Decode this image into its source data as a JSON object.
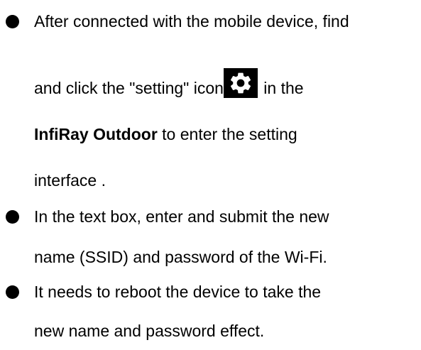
{
  "bullets": [
    {
      "lines": [
        "After connected with the mobile device, find",
        "and click the \"setting\" icon",
        " in the",
        "InfiRay Outdoor",
        " to enter the setting",
        "interface ."
      ]
    },
    {
      "lines": [
        "In the text box, enter and submit the new",
        "name (SSID) and password of the Wi-Fi."
      ]
    },
    {
      "lines": [
        "It needs to reboot the device to take the",
        "new name and password effect."
      ]
    }
  ],
  "icons": {
    "settings": "gear-icon"
  }
}
